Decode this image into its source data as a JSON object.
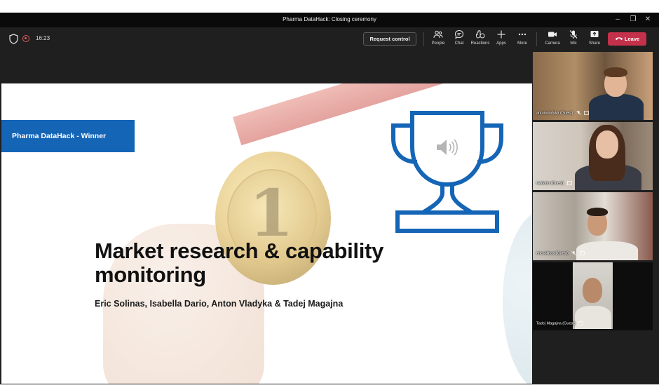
{
  "window": {
    "title": "Pharma DataHack: Closing ceremony",
    "controls": {
      "minimize": "–",
      "restore": "❐",
      "close": "✕"
    }
  },
  "toolbar": {
    "timer": "16:23",
    "request_control": "Request control",
    "items": [
      {
        "label": "People",
        "icon": "people-icon"
      },
      {
        "label": "Chat",
        "icon": "chat-icon"
      },
      {
        "label": "Reactions",
        "icon": "reactions-icon"
      },
      {
        "label": "Apps",
        "icon": "plus-icon"
      },
      {
        "label": "More",
        "icon": "more-icon"
      },
      {
        "label": "Camera",
        "icon": "camera-icon"
      },
      {
        "label": "Mic",
        "icon": "mic-off-icon"
      },
      {
        "label": "Share",
        "icon": "share-icon"
      }
    ],
    "leave": "Leave"
  },
  "slide": {
    "badge": "Pharma DataHack - Winner",
    "title_line1": "Market research & capability",
    "title_line2": "monitoring",
    "authors": "Eric Solinas, Isabella Dario, Anton Vladyka & Tadej Magajna",
    "medal_number": "1",
    "colors": {
      "badge": "#1565b7",
      "trophy": "#1565b7"
    }
  },
  "participants": [
    {
      "name": "antonvladyka (Guest)"
    },
    {
      "name": "isadario (Guest)"
    },
    {
      "name": "ericsolinas (Guest)"
    },
    {
      "name": "Tadej Magajna (Guest)"
    }
  ],
  "colors": {
    "leave": "#c4314b",
    "toolbar": "#1f1f1f",
    "titlebar": "#0a0a0a"
  }
}
